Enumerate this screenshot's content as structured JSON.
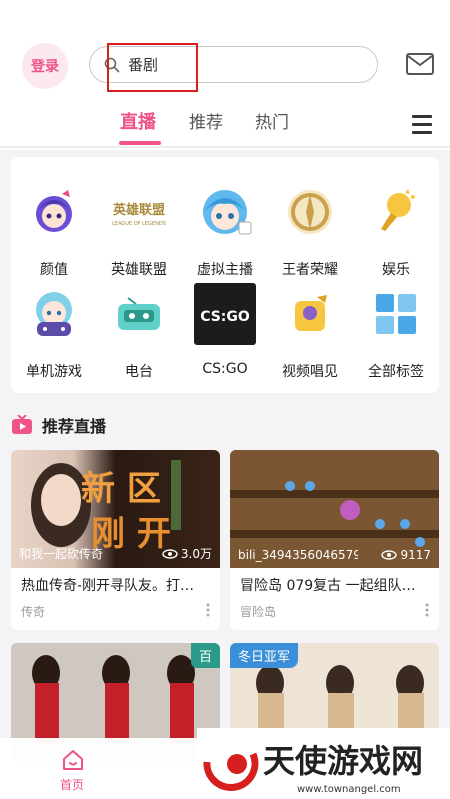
{
  "header": {
    "login_label": "登录",
    "search_value": "番剧",
    "search_icon": "search-icon",
    "mail_icon": "mail-icon"
  },
  "tabs": [
    {
      "label": "直播",
      "active": true
    },
    {
      "label": "推荐",
      "active": false
    },
    {
      "label": "热门",
      "active": false
    }
  ],
  "categories": [
    {
      "label": "颜值",
      "icon": "beauty-mascot-icon"
    },
    {
      "label": "英雄联盟",
      "icon": "lol-logo-icon"
    },
    {
      "label": "虚拟主播",
      "icon": "vtuber-mascot-icon"
    },
    {
      "label": "王者荣耀",
      "icon": "honor-of-kings-icon"
    },
    {
      "label": "娱乐",
      "icon": "microphone-icon"
    },
    {
      "label": "单机游戏",
      "icon": "gamepad-mascot-icon"
    },
    {
      "label": "电台",
      "icon": "radio-icon"
    },
    {
      "label": "CS:GO",
      "icon": "csgo-logo-icon"
    },
    {
      "label": "视频唱见",
      "icon": "sing-microphone-icon"
    },
    {
      "label": "全部标签",
      "icon": "grid-tags-icon"
    }
  ],
  "section": {
    "title": "推荐直播",
    "icon": "tv-icon"
  },
  "cards": [
    {
      "user": "和我一起砍传奇",
      "views": "3.0万",
      "title": "热血传奇-刚开寻队友。打…",
      "category": "传奇",
      "thumb_text": "新区刚开"
    },
    {
      "user": "bili_3494356046579…",
      "views": "9117",
      "title": "冒险岛 079复古 一起组队…",
      "category": "冒险岛"
    },
    {
      "badge": "百",
      "badge_color": "#2b9a8a"
    },
    {
      "badge": "冬日亚军",
      "badge_color": "#3b8fd9"
    }
  ],
  "bottom_nav": {
    "home_label": "首页",
    "accent": "#f0528a"
  },
  "watermark": {
    "text": "天使游戏网",
    "url": "www.townangel.com"
  },
  "colors": {
    "accent": "#f0528a",
    "background": "#f4f4f6"
  }
}
